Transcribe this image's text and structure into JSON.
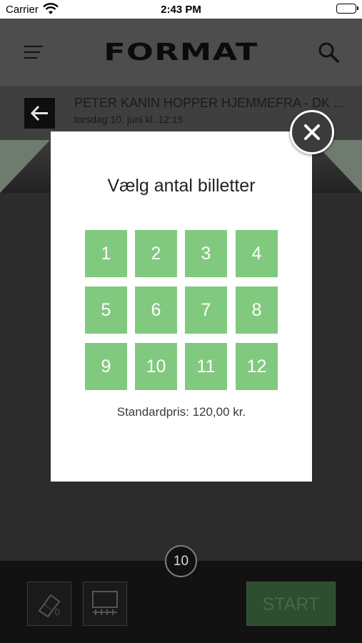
{
  "status_bar": {
    "carrier": "Carrier",
    "time": "2:43 PM"
  },
  "header": {
    "logo_text": "FORMAT",
    "icons": [
      "menu-icon",
      "search-icon"
    ]
  },
  "event": {
    "title": "PETER KANIN HOPPER HJEMMEFRA - DK ...",
    "datetime": "torsdag 10. juni kl. 12:15"
  },
  "modal": {
    "title": "Vælg antal billetter",
    "options": [
      "1",
      "2",
      "3",
      "4",
      "5",
      "6",
      "7",
      "8",
      "9",
      "10",
      "11",
      "12"
    ],
    "price": "Standardpris: 120,00 kr.",
    "accent_color": "#81c97f"
  },
  "bottom": {
    "seat_count": "0",
    "ticket_count": "10",
    "start_label": "START"
  }
}
